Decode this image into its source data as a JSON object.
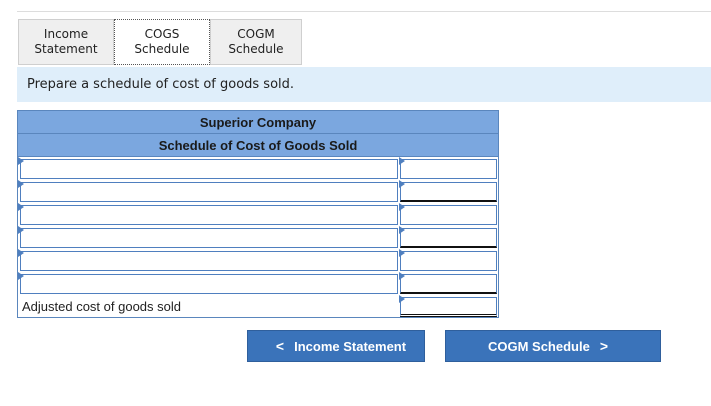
{
  "tabs": [
    {
      "label": "Income\nStatement",
      "active": false
    },
    {
      "label": "COGS\nSchedule",
      "active": true
    },
    {
      "label": "COGM\nSchedule",
      "active": false
    }
  ],
  "instruction": "Prepare a schedule of cost of goods sold.",
  "schedule": {
    "company": "Superior Company",
    "title": "Schedule of Cost of Goods Sold",
    "rows": [
      {
        "label": "",
        "amount": ""
      },
      {
        "label": "",
        "amount": ""
      },
      {
        "label": "",
        "amount": ""
      },
      {
        "label": "",
        "amount": ""
      },
      {
        "label": "",
        "amount": ""
      },
      {
        "label": "",
        "amount": ""
      },
      {
        "label": "Adjusted cost of goods sold",
        "amount": ""
      }
    ]
  },
  "nav": {
    "prev_label": "Income Statement",
    "next_label": "COGM Schedule"
  },
  "icons": {
    "prev": "chevron-left-icon",
    "next": "chevron-right-icon",
    "dropdown_marker": "triangle-marker-icon"
  },
  "colors": {
    "header_bg": "#7ba7df",
    "instruction_bg": "#dfeefa",
    "button_bg": "#3a73ba"
  }
}
